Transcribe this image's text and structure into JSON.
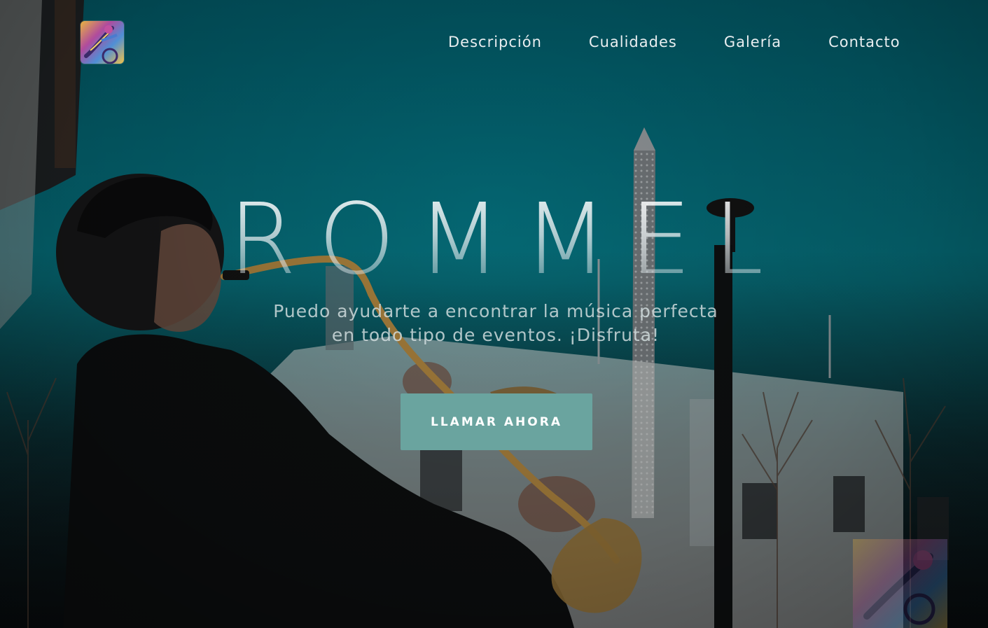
{
  "logo": {
    "icon": "saxophone-logo-icon"
  },
  "nav": {
    "items": [
      {
        "label": "Descripción"
      },
      {
        "label": "Cualidades"
      },
      {
        "label": "Galería"
      },
      {
        "label": "Contacto"
      }
    ]
  },
  "hero": {
    "title": "ROMMEL",
    "subtitle_line1": "Puedo ayudarte a encontrar la música perfecta",
    "subtitle_line2": "en todo tipo de eventos. ¡Disfruta!",
    "cta_label": "LLAMAR AHORA"
  },
  "colors": {
    "sky": "#03606c",
    "cta": "#6aa49f",
    "text": "#e9eef0"
  }
}
